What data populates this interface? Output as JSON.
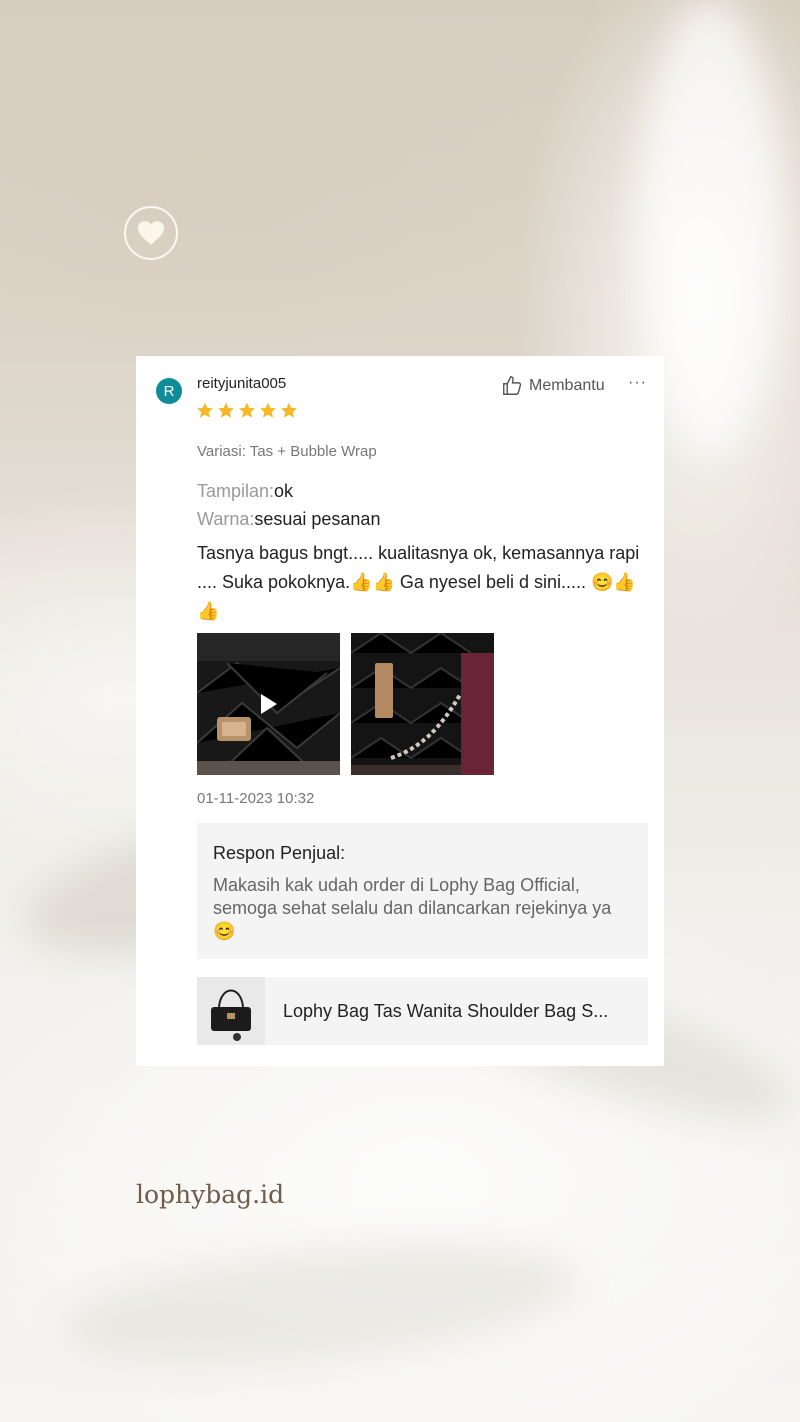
{
  "review": {
    "avatar_initial": "R",
    "username": "reityjunita005",
    "rating": 5,
    "helpful_label": "Membantu",
    "more_label": "···",
    "variation": "Variasi: Tas + Bubble Wrap",
    "attributes": [
      {
        "key": "Tampilan:",
        "value": "ok"
      },
      {
        "key": "Warna:",
        "value": "sesuai pesanan"
      }
    ],
    "text": "Tasnya bagus bngt..... kualitasnya ok, kemasannya rapi .... Suka pokoknya.👍👍 Ga nyesel beli d sini..... 😊👍👍",
    "date": "01-11-2023 10:32"
  },
  "seller_response": {
    "title": "Respon Penjual:",
    "body": "Makasih kak udah order di Lophy Bag Official, semoga sehat selalu dan dilancarkan rejekinya ya 😊"
  },
  "product": {
    "name": "Lophy Bag Tas Wanita Shoulder Bag S..."
  },
  "watermark": "lophybag.id",
  "colors": {
    "star": "#f6b826",
    "avatar": "#0e8c99"
  }
}
